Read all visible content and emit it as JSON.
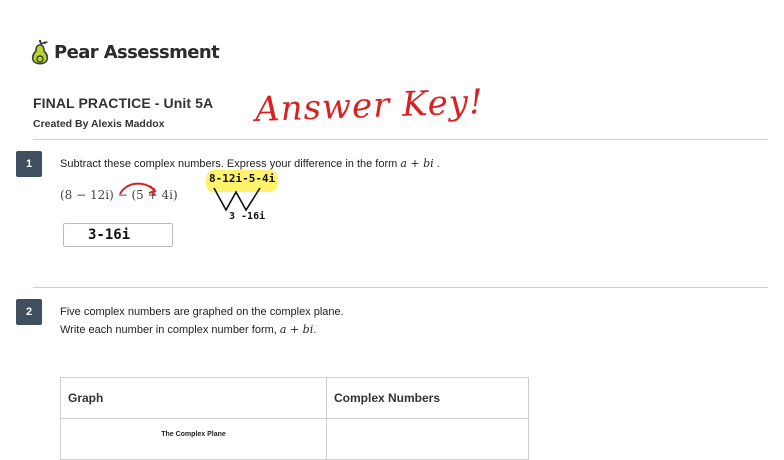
{
  "header": {
    "brand": "Pear Assessment",
    "title": "FINAL PRACTICE - Unit 5A",
    "author": "Created By Alexis Maddox",
    "annotation": "Answer Key!"
  },
  "questions": [
    {
      "number": "1",
      "text": "Subtract these complex numbers.  Express your difference in the form",
      "form": "a + bi",
      "text_end": " .",
      "expression": "(8 − 12i) − (5 + 4i)",
      "handwritten_work": "8-12i-5-4i",
      "handwritten_result": "3 -16i",
      "answer": "3-16i"
    },
    {
      "number": "2",
      "line1": "Five complex numbers are graphed on the complex plane.",
      "line2": "Write each number in complex number form,",
      "form": "a + bi",
      "line2_end": ".",
      "table": {
        "headers": [
          "Graph",
          "Complex Numbers"
        ],
        "graph_title": "The Complex Plane"
      }
    }
  ],
  "colors": {
    "ink": "#d62222",
    "badge": "#3f4f5f",
    "divider": "#cfcfcf"
  }
}
